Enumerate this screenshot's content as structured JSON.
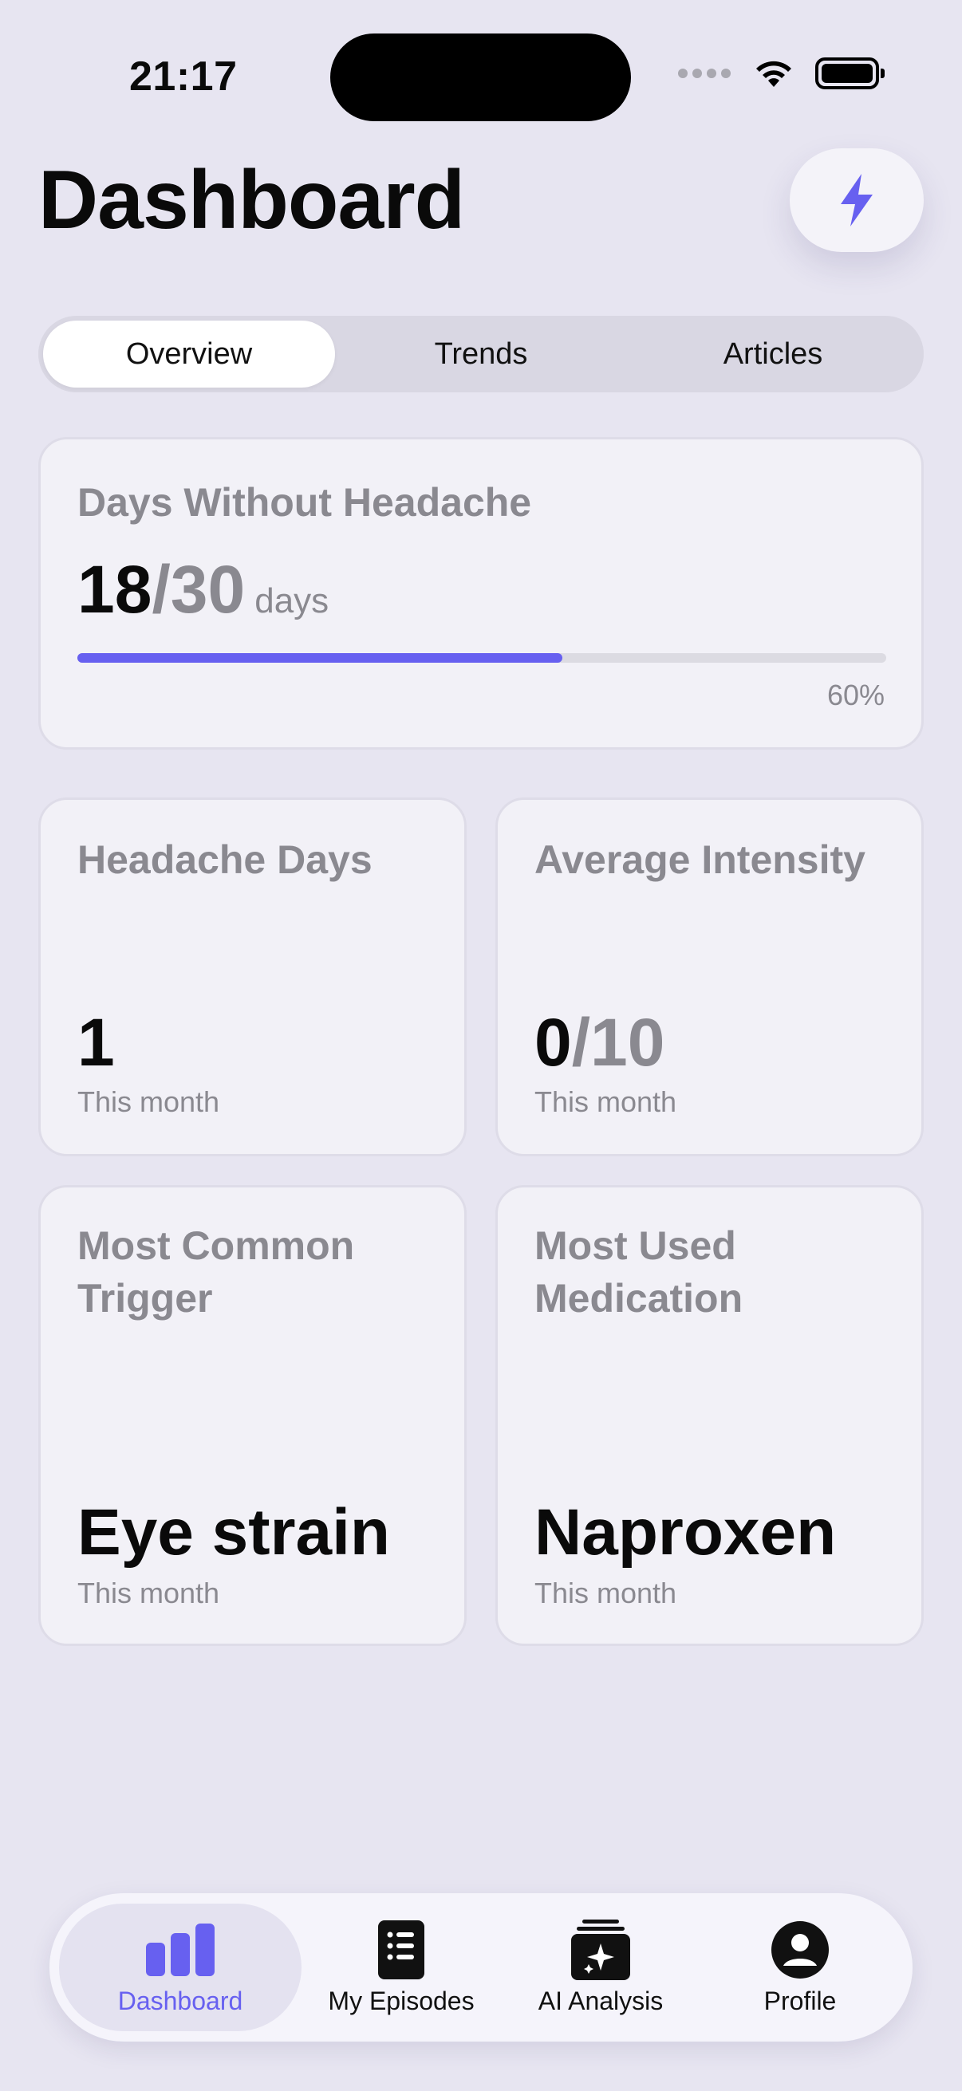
{
  "status_bar": {
    "time": "21:17"
  },
  "header": {
    "title": "Dashboard",
    "quick_action_icon": "lightning-bolt-icon"
  },
  "tabs": [
    {
      "label": "Overview",
      "active": true
    },
    {
      "label": "Trends",
      "active": false
    },
    {
      "label": "Articles",
      "active": false
    }
  ],
  "days_without_headache": {
    "label": "Days Without Headache",
    "value": "18",
    "total": "/30",
    "unit": "days",
    "progress": 0.6,
    "percent_label": "60%"
  },
  "stats": {
    "headache_days": {
      "label": "Headache Days",
      "value": "1",
      "sub": "This month"
    },
    "average_intensity": {
      "label": "Average Intensity",
      "value": "0",
      "total": "/10",
      "sub": "This month"
    },
    "most_common_trigger": {
      "label": "Most Common Trigger",
      "value": "Eye strain",
      "sub": "This month"
    },
    "most_used_medication": {
      "label": "Most Used Medication",
      "value": "Naproxen",
      "sub": "This month"
    }
  },
  "bottom_nav": [
    {
      "label": "Dashboard",
      "icon": "bar-chart-icon",
      "active": true
    },
    {
      "label": "My Episodes",
      "icon": "list-icon",
      "active": false
    },
    {
      "label": "AI Analysis",
      "icon": "sparkle-stack-icon",
      "active": false
    },
    {
      "label": "Profile",
      "icon": "person-circle-icon",
      "active": false
    }
  ],
  "colors": {
    "accent": "#6760F0",
    "background": "#E7E5F1",
    "card": "#F2F1F7",
    "muted_text": "#8A8990"
  }
}
